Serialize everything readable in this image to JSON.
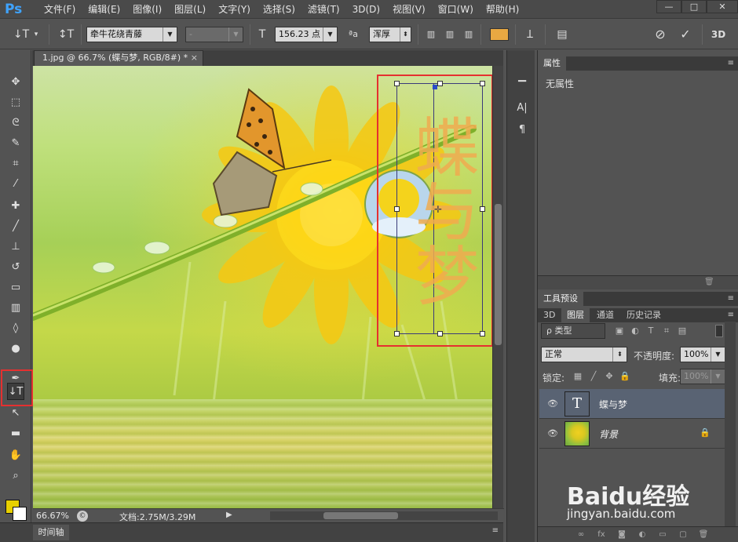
{
  "app": {
    "logo": "Ps"
  },
  "menu": [
    "文件(F)",
    "编辑(E)",
    "图像(I)",
    "图层(L)",
    "文字(Y)",
    "选择(S)",
    "滤镜(T)",
    "3D(D)",
    "视图(V)",
    "窗口(W)",
    "帮助(H)"
  ],
  "window_controls": {
    "minimize": "—",
    "maximize": "□",
    "close": "✕"
  },
  "options": {
    "tool_icon": "↓T",
    "orientation_icon": "↕T",
    "font_family": "牵牛花绕青藤",
    "font_style": "-",
    "size_icon": "T",
    "font_size": "156.23 点",
    "aa_icon": "ªa",
    "antialias": "浑厚",
    "warp_icon": "Ʇ",
    "panel_icon": "▤",
    "cancel_icon": "⊘",
    "commit_icon": "✓",
    "three_d": "3D",
    "text_color": "#e8a842"
  },
  "document": {
    "tab_title": "1.jpg @ 66.7% (蝶与梦, RGB/8#) *",
    "close": "×",
    "text_layer_content": "蝶与梦",
    "text_color": "#f0ac50"
  },
  "status": {
    "zoom": "66.67%",
    "doc_info": "文档:2.75M/3.29M",
    "arrow": "▶"
  },
  "timeline": {
    "tab": "时间轴"
  },
  "tools": [
    {
      "name": "move-tool-icon",
      "glyph": "✥"
    },
    {
      "name": "marquee-tool-icon",
      "glyph": "⬚"
    },
    {
      "name": "lasso-tool-icon",
      "glyph": "ᘓ"
    },
    {
      "name": "quick-select-tool-icon",
      "glyph": "✎"
    },
    {
      "name": "crop-tool-icon",
      "glyph": "⌗"
    },
    {
      "name": "eyedropper-tool-icon",
      "glyph": "⁄"
    },
    {
      "name": "healing-brush-tool-icon",
      "glyph": "✚"
    },
    {
      "name": "brush-tool-icon",
      "glyph": "╱"
    },
    {
      "name": "clone-stamp-tool-icon",
      "glyph": "⊥"
    },
    {
      "name": "history-brush-tool-icon",
      "glyph": "↺"
    },
    {
      "name": "eraser-tool-icon",
      "glyph": "▭"
    },
    {
      "name": "gradient-tool-icon",
      "glyph": "▥"
    },
    {
      "name": "blur-tool-icon",
      "glyph": "◊"
    },
    {
      "name": "dodge-tool-icon",
      "glyph": "●"
    },
    {
      "name": "pen-tool-icon",
      "glyph": "✒"
    },
    {
      "name": "vertical-type-tool-icon",
      "glyph": "↓T"
    },
    {
      "name": "path-select-tool-icon",
      "glyph": "↖"
    },
    {
      "name": "rectangle-tool-icon",
      "glyph": "▬"
    },
    {
      "name": "hand-tool-icon",
      "glyph": "✋"
    },
    {
      "name": "zoom-tool-icon",
      "glyph": "⌕"
    }
  ],
  "mini_dock": {
    "ico1": "▁",
    "ico2": "A|",
    "ico3": "¶"
  },
  "properties": {
    "tab": "属性",
    "empty_text": "无属性",
    "menu": "≡"
  },
  "tool_presets": {
    "tab": "工具预设"
  },
  "layers_panel": {
    "tabs": [
      "3D",
      "图层",
      "通道",
      "历史记录"
    ],
    "filter": "ρ 类型",
    "blend_mode": "正常",
    "opacity_label": "不透明度:",
    "opacity": "100%",
    "lock_label": "锁定:",
    "fill_label": "填充:",
    "fill": "100%",
    "layers": [
      {
        "name": "蝶与梦",
        "type": "text",
        "thumb": "T",
        "selected": true
      },
      {
        "name": "背景",
        "type": "image",
        "locked": true,
        "selected": false
      }
    ]
  },
  "watermark": {
    "text": "Baidu经验",
    "url": "jingyan.baidu.com"
  }
}
